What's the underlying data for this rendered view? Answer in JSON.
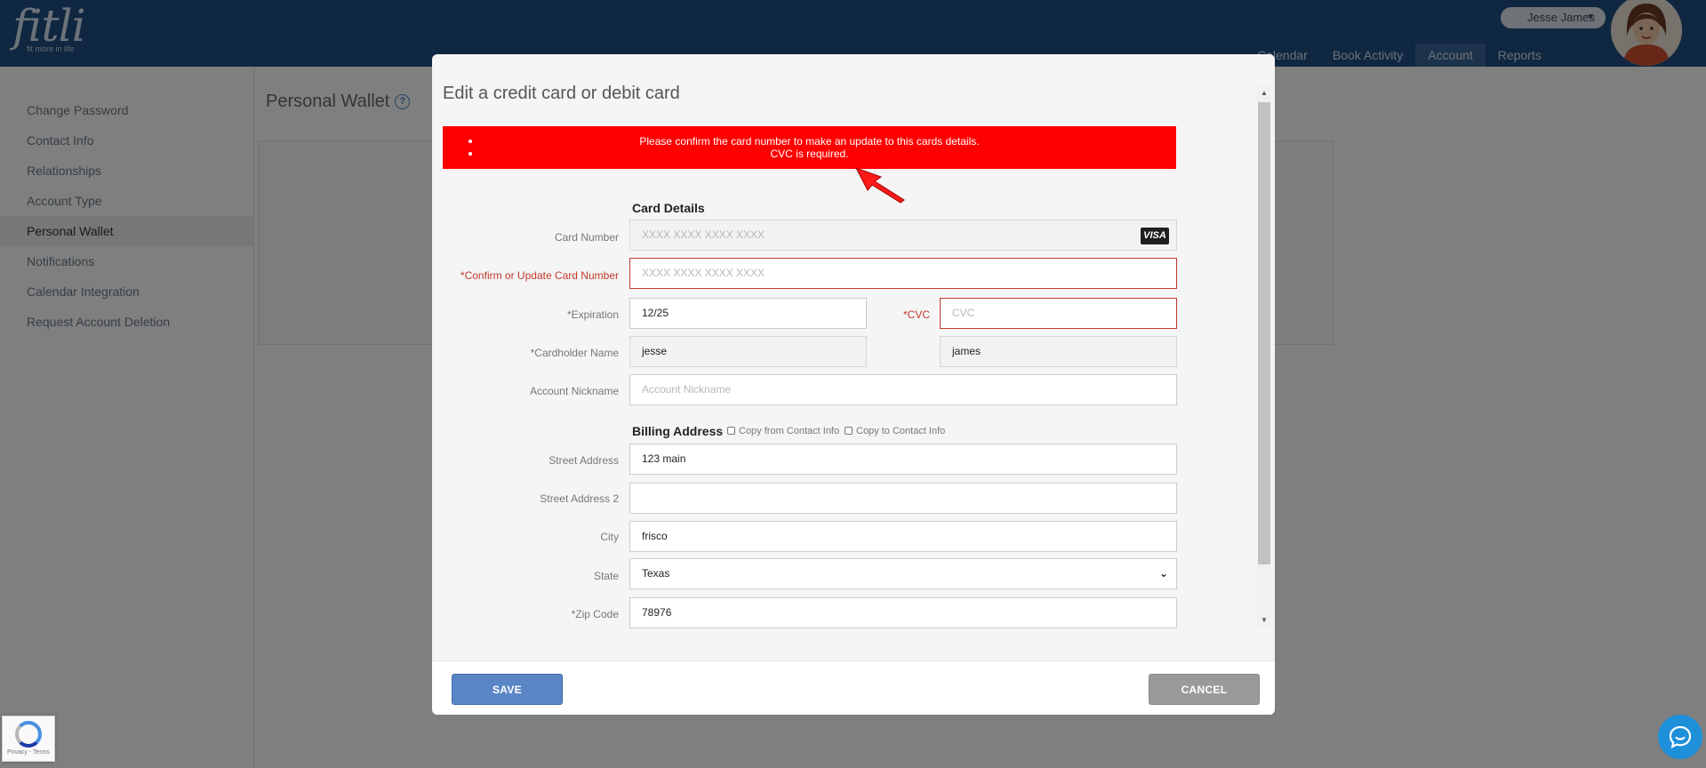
{
  "app": {
    "logo": "fitli",
    "tagline": "fit more in life"
  },
  "header": {
    "user_name": "Jesse James",
    "user_caret": "▼",
    "nav": [
      "Calendar",
      "Book Activity",
      "Account",
      "Reports"
    ]
  },
  "sidebar": {
    "items": [
      "Change Password",
      "Contact Info",
      "Relationships",
      "Account Type",
      "Personal Wallet",
      "Notifications",
      "Calendar Integration",
      "Request Account Deletion"
    ]
  },
  "content": {
    "title": "Personal Wallet",
    "help": "?"
  },
  "modal": {
    "title": "Edit a credit card or debit card",
    "errors": [
      "Please confirm the card number to make an update to this cards details.",
      "CVC is required."
    ],
    "card_section": "Card Details",
    "fields": {
      "card_number": {
        "label": "Card Number",
        "placeholder": "XXXX XXXX XXXX XXXX",
        "brand": "VISA"
      },
      "confirm_card": {
        "label": "*Confirm or Update Card Number",
        "placeholder": "XXXX XXXX XXXX XXXX"
      },
      "expiration": {
        "label": "*Expiration",
        "value": "12/25"
      },
      "cvc": {
        "label": "*CVC",
        "placeholder": "CVC"
      },
      "cardholder": {
        "label": "*Cardholder Name",
        "first": "jesse",
        "last": "james"
      },
      "nickname": {
        "label": "Account Nickname",
        "placeholder": "Account Nickname"
      }
    },
    "billing": {
      "section": "Billing Address",
      "copy_from": "Copy from Contact Info",
      "copy_to": "Copy to Contact Info",
      "street": {
        "label": "Street Address",
        "value": "123 main"
      },
      "street2": {
        "label": "Street Address 2",
        "value": ""
      },
      "city": {
        "label": "City",
        "value": "frisco"
      },
      "state": {
        "label": "State",
        "value": "Texas"
      },
      "zip": {
        "label": "*Zip Code",
        "value": "78976"
      }
    },
    "buttons": {
      "save": "SAVE",
      "cancel": "CANCEL"
    }
  },
  "recaptcha": {
    "text": "Privacy - Terms"
  },
  "colors": {
    "header": "#1f4f82",
    "error": "#ff0000",
    "save": "#5b86c5",
    "cancel": "#9a9a9a",
    "required": "#c0392b"
  }
}
